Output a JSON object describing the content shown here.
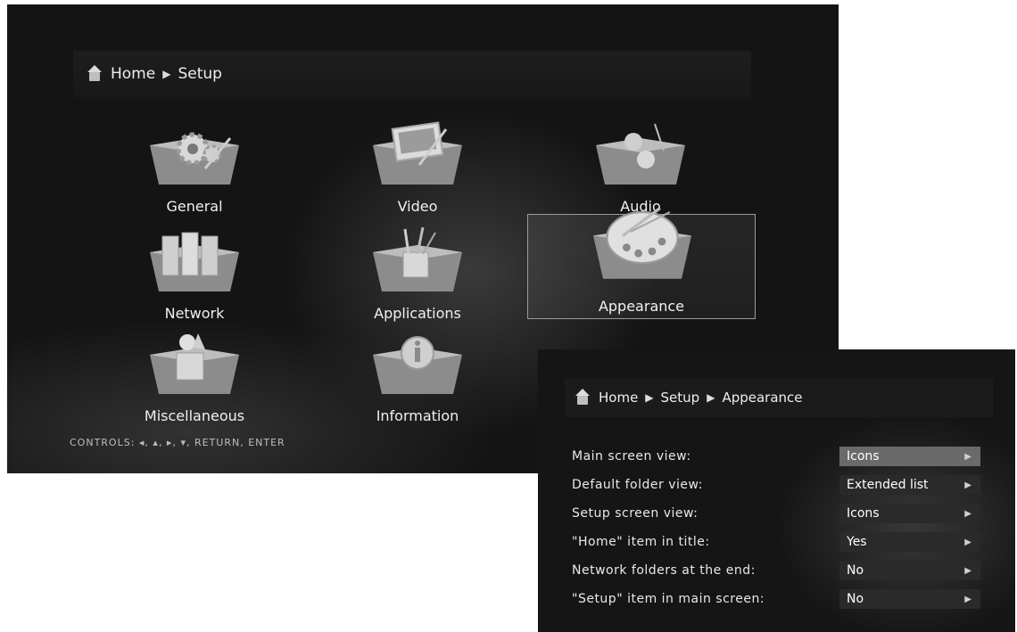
{
  "main_screen": {
    "breadcrumb": {
      "home": "Home",
      "current": "Setup"
    },
    "tiles": [
      {
        "label": "General"
      },
      {
        "label": "Video"
      },
      {
        "label": "Audio"
      },
      {
        "label": "Network"
      },
      {
        "label": "Applications"
      },
      {
        "label": "Appearance",
        "selected": true
      },
      {
        "label": "Miscellaneous"
      },
      {
        "label": "Information"
      }
    ],
    "controls": "CONTROLS:   ◂, ▴, ▸, ▾, RETURN, ENTER"
  },
  "appearance_screen": {
    "breadcrumb": {
      "home": "Home",
      "parent": "Setup",
      "current": "Appearance"
    },
    "settings": [
      {
        "label": "Main screen view:",
        "value": "Icons",
        "active": true
      },
      {
        "label": "Default folder view:",
        "value": "Extended list"
      },
      {
        "label": "Setup screen view:",
        "value": "Icons"
      },
      {
        "label": "\"Home\" item in title:",
        "value": "Yes"
      },
      {
        "label": "Network folders at the end:",
        "value": "No"
      },
      {
        "label": "\"Setup\" item in main screen:",
        "value": "No"
      }
    ]
  }
}
